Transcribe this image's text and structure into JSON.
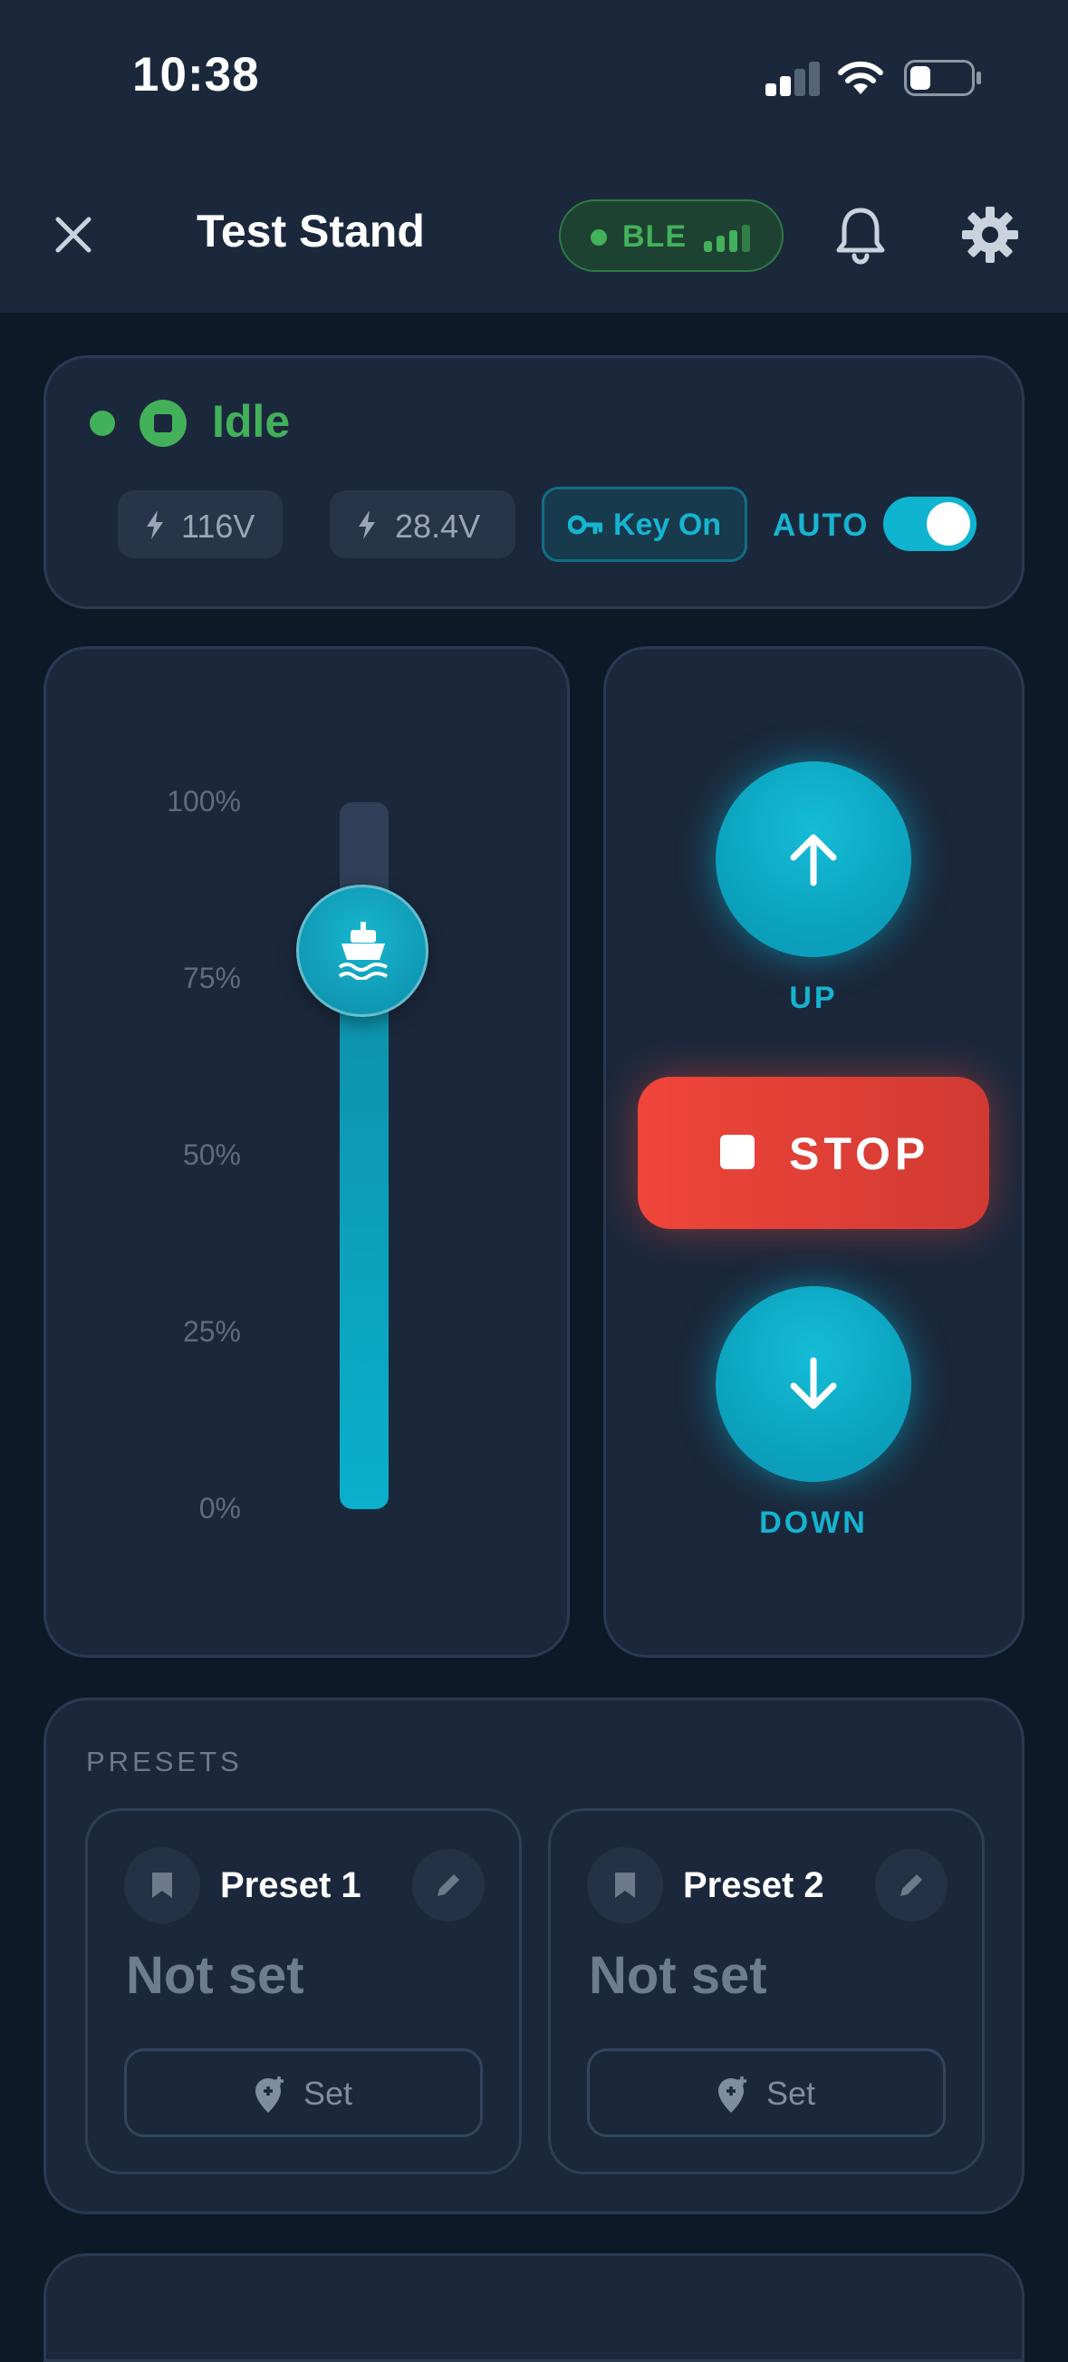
{
  "status_bar": {
    "time": "10:38"
  },
  "header": {
    "close_icon": "close-icon",
    "title": "Test Stand",
    "ble_label": "BLE",
    "bell_icon": "bell-icon",
    "gear_icon": "gear-icon"
  },
  "status": {
    "state_label": "Idle",
    "state_color": "#43b05a"
  },
  "chips": {
    "voltage1": "116V",
    "voltage2": "28.4V",
    "key_label": "Key On",
    "auto_label": "AUTO",
    "auto_on": true
  },
  "slider": {
    "ticks": [
      "100%",
      "75%",
      "50%",
      "25%",
      "0%"
    ],
    "level_percent": 79,
    "thumb_icon": "boat-icon"
  },
  "controls": {
    "up_label": "UP",
    "stop_label": "STOP",
    "down_label": "DOWN"
  },
  "presets": {
    "section_title": "PRESETS",
    "items": [
      {
        "name": "Preset 1",
        "value": "Not set",
        "set_label": "Set"
      },
      {
        "name": "Preset 2",
        "value": "Not set",
        "set_label": "Set"
      }
    ]
  },
  "colors": {
    "accent": "#0fb4d0",
    "stop": "#e8443a",
    "ok": "#43b05a",
    "background": "#0e1928",
    "card": "#1b283c"
  }
}
